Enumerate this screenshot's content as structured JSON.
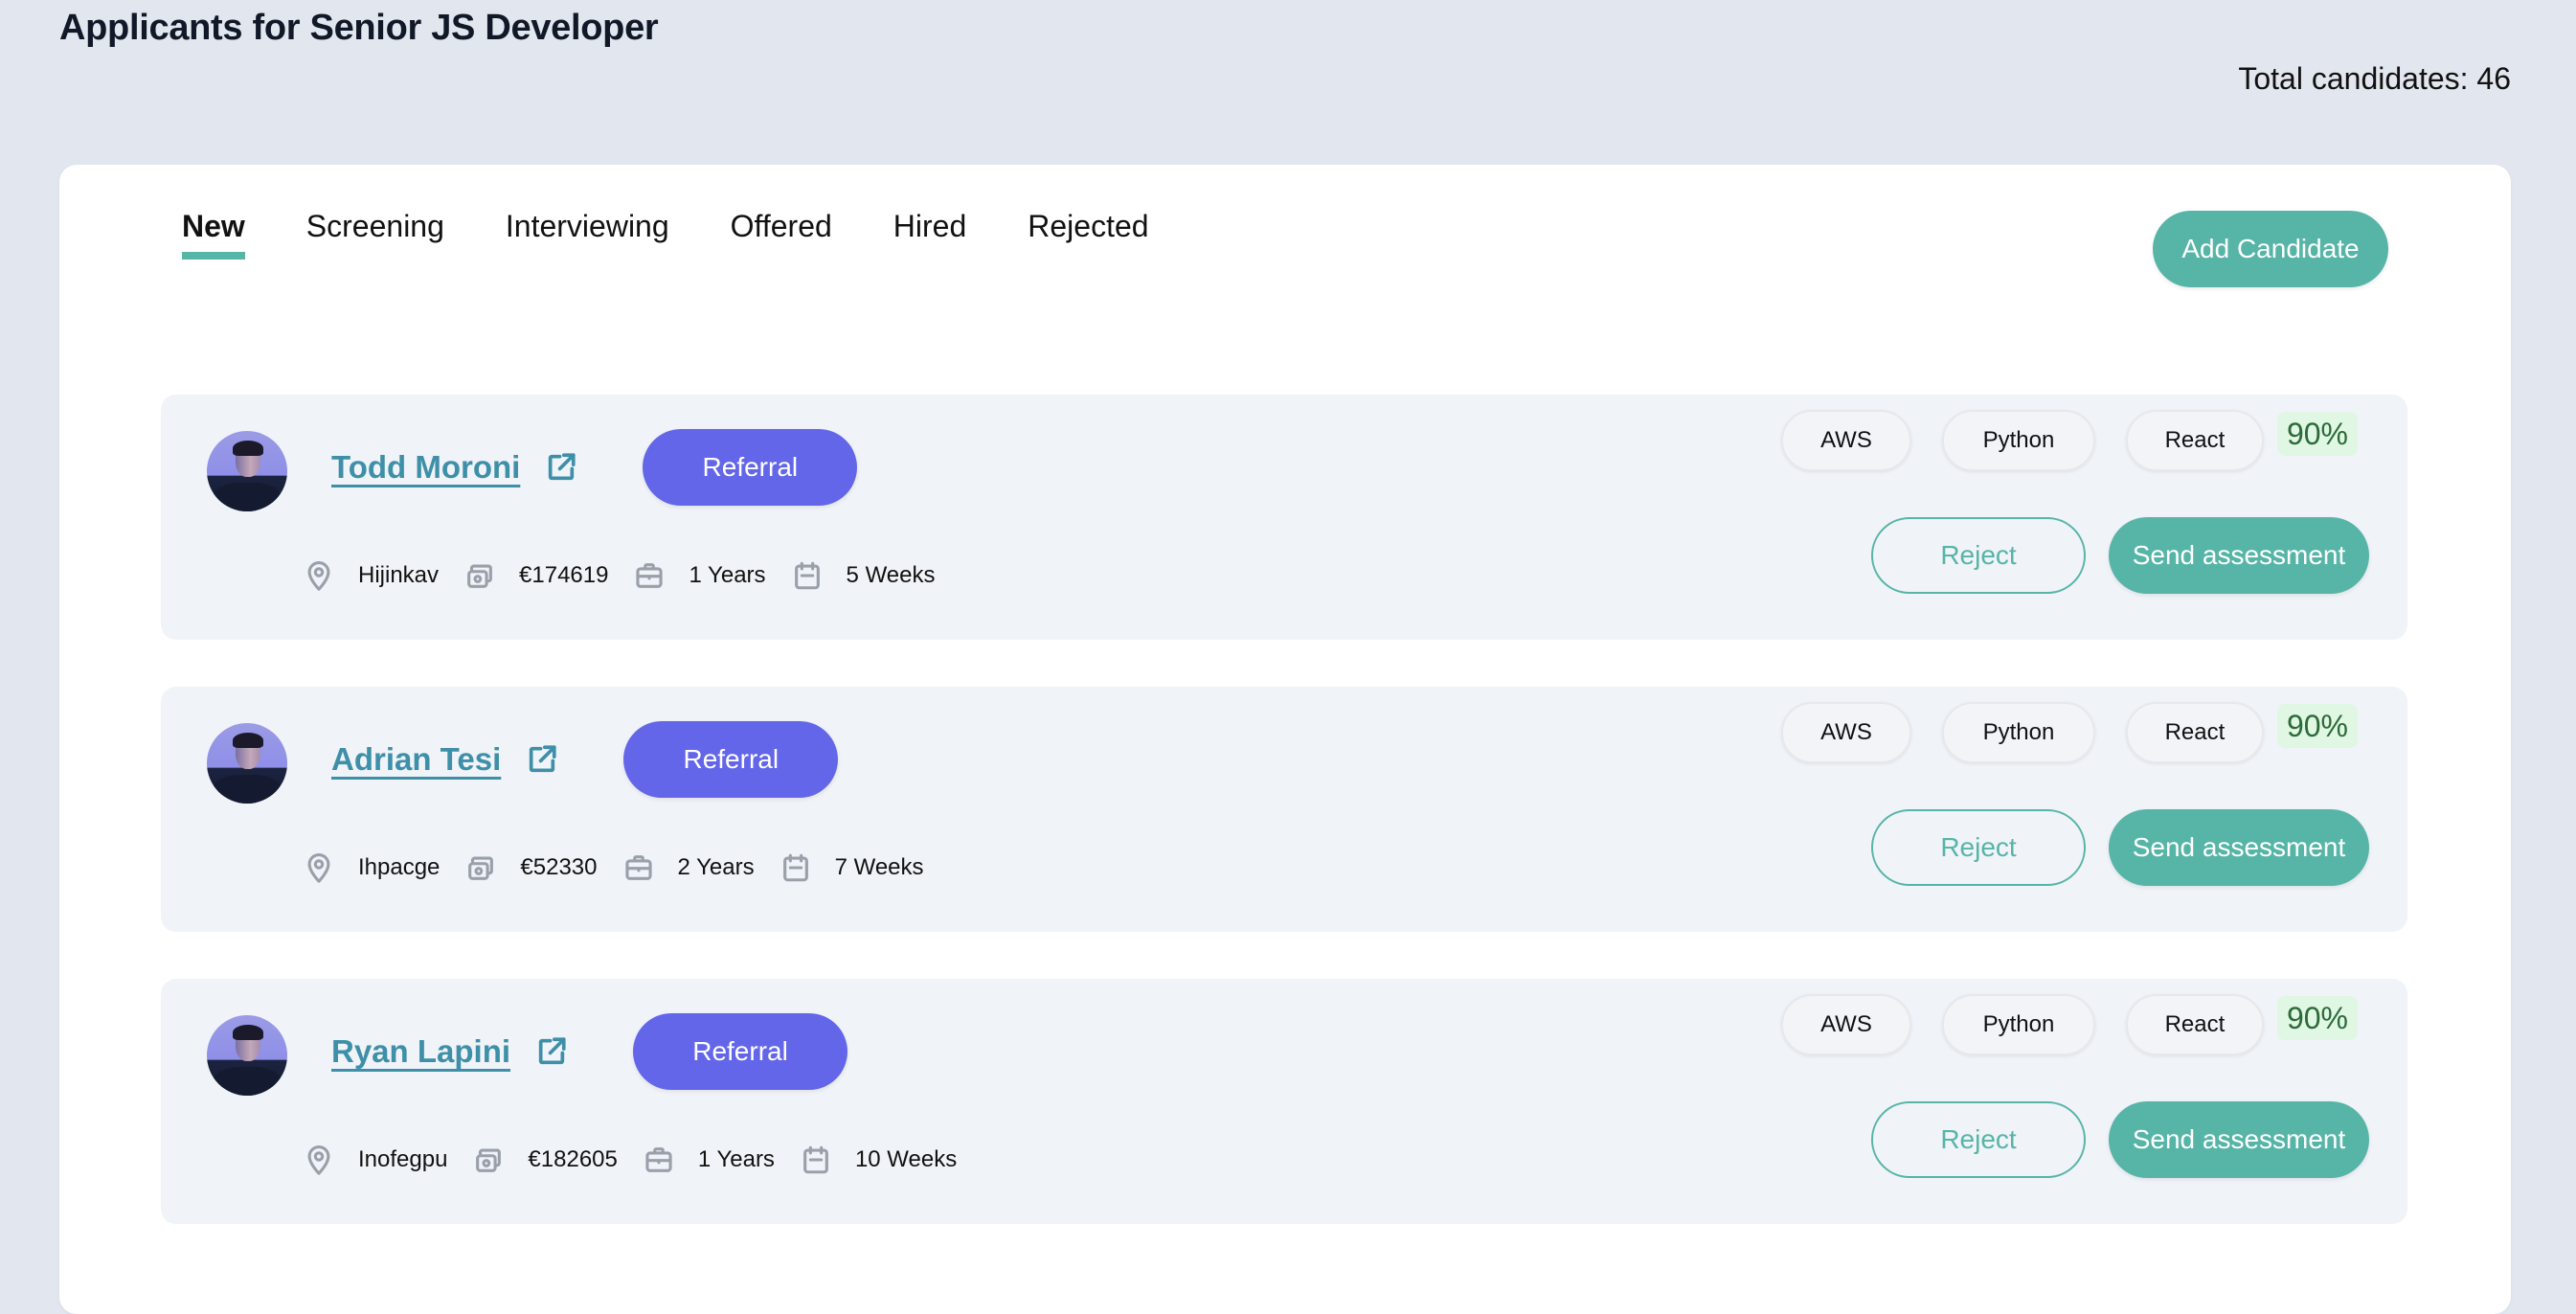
{
  "header": {
    "title": "Applicants for Senior JS Developer",
    "total_candidates_label": "Total candidates: 46"
  },
  "tabs": [
    {
      "label": "New",
      "active": true
    },
    {
      "label": "Screening",
      "active": false
    },
    {
      "label": "Interviewing",
      "active": false
    },
    {
      "label": "Offered",
      "active": false
    },
    {
      "label": "Hired",
      "active": false
    },
    {
      "label": "Rejected",
      "active": false
    }
  ],
  "actions": {
    "add_candidate_label": "Add Candidate"
  },
  "icons": {
    "location": "location-pin-icon",
    "salary": "money-icon",
    "experience": "briefcase-icon",
    "notice": "calendar-icon",
    "profile_link": "external-link-icon"
  },
  "colors": {
    "accent": "#56b5a7",
    "referral": "#6366e8",
    "name_link": "#3e8fa8",
    "score_bg": "#e0f7e3",
    "score_text": "#2d6a3a",
    "page_bg": "#e2e7ef",
    "card_bg": "#f0f3f8"
  },
  "candidates": [
    {
      "name": "Todd Moroni",
      "source_label": "Referral",
      "location": "Hijinkav",
      "salary": "€174619",
      "experience": "1 Years",
      "notice": "5 Weeks",
      "skills": [
        "AWS",
        "Python",
        "React"
      ],
      "match": "90%",
      "reject_label": "Reject",
      "send_label": "Send assessment"
    },
    {
      "name": "Adrian Tesi",
      "source_label": "Referral",
      "location": "Ihpacge",
      "salary": "€52330",
      "experience": "2 Years",
      "notice": "7 Weeks",
      "skills": [
        "AWS",
        "Python",
        "React"
      ],
      "match": "90%",
      "reject_label": "Reject",
      "send_label": "Send assessment"
    },
    {
      "name": "Ryan Lapini",
      "source_label": "Referral",
      "location": "Inofegpu",
      "salary": "€182605",
      "experience": "1 Years",
      "notice": "10 Weeks",
      "skills": [
        "AWS",
        "Python",
        "React"
      ],
      "match": "90%",
      "reject_label": "Reject",
      "send_label": "Send assessment"
    }
  ]
}
